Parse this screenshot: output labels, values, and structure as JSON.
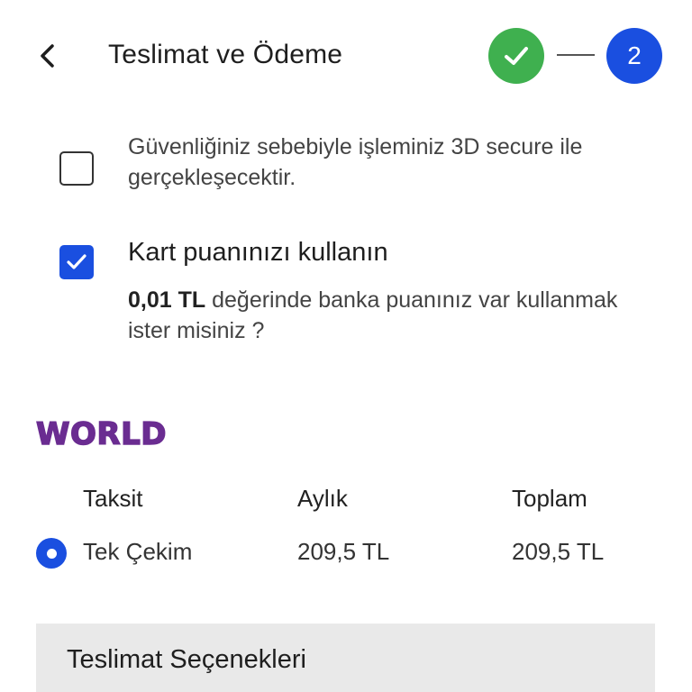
{
  "header": {
    "title": "Teslimat ve Ödeme",
    "back_icon": "chevron-left-icon",
    "steps": {
      "completed_icon": "check-icon",
      "current_number": "2"
    }
  },
  "secure_option": {
    "checked": false,
    "text": "Güvenliğiniz sebebiyle işleminiz 3D secure ile gerçekleşecektir."
  },
  "points_option": {
    "checked": true,
    "title": "Kart puanınızı kullanın",
    "amount": "0,01 TL",
    "description": " değerinde banka puanınız var kullanmak ister misiniz ?"
  },
  "card_program": {
    "logo_text": "WORLD",
    "logo_color": "#6a2c91"
  },
  "installments": {
    "headers": [
      "Taksit",
      "Aylık",
      "Toplam"
    ],
    "rows": [
      {
        "selected": true,
        "label": "Tek Çekim",
        "monthly": "209,5 TL",
        "total": "209,5 TL"
      }
    ]
  },
  "delivery": {
    "title": "Teslimat Seçenekleri"
  },
  "colors": {
    "primary": "#1a4fe0",
    "success": "#3fb04f",
    "panel": "#e9e9e9"
  }
}
